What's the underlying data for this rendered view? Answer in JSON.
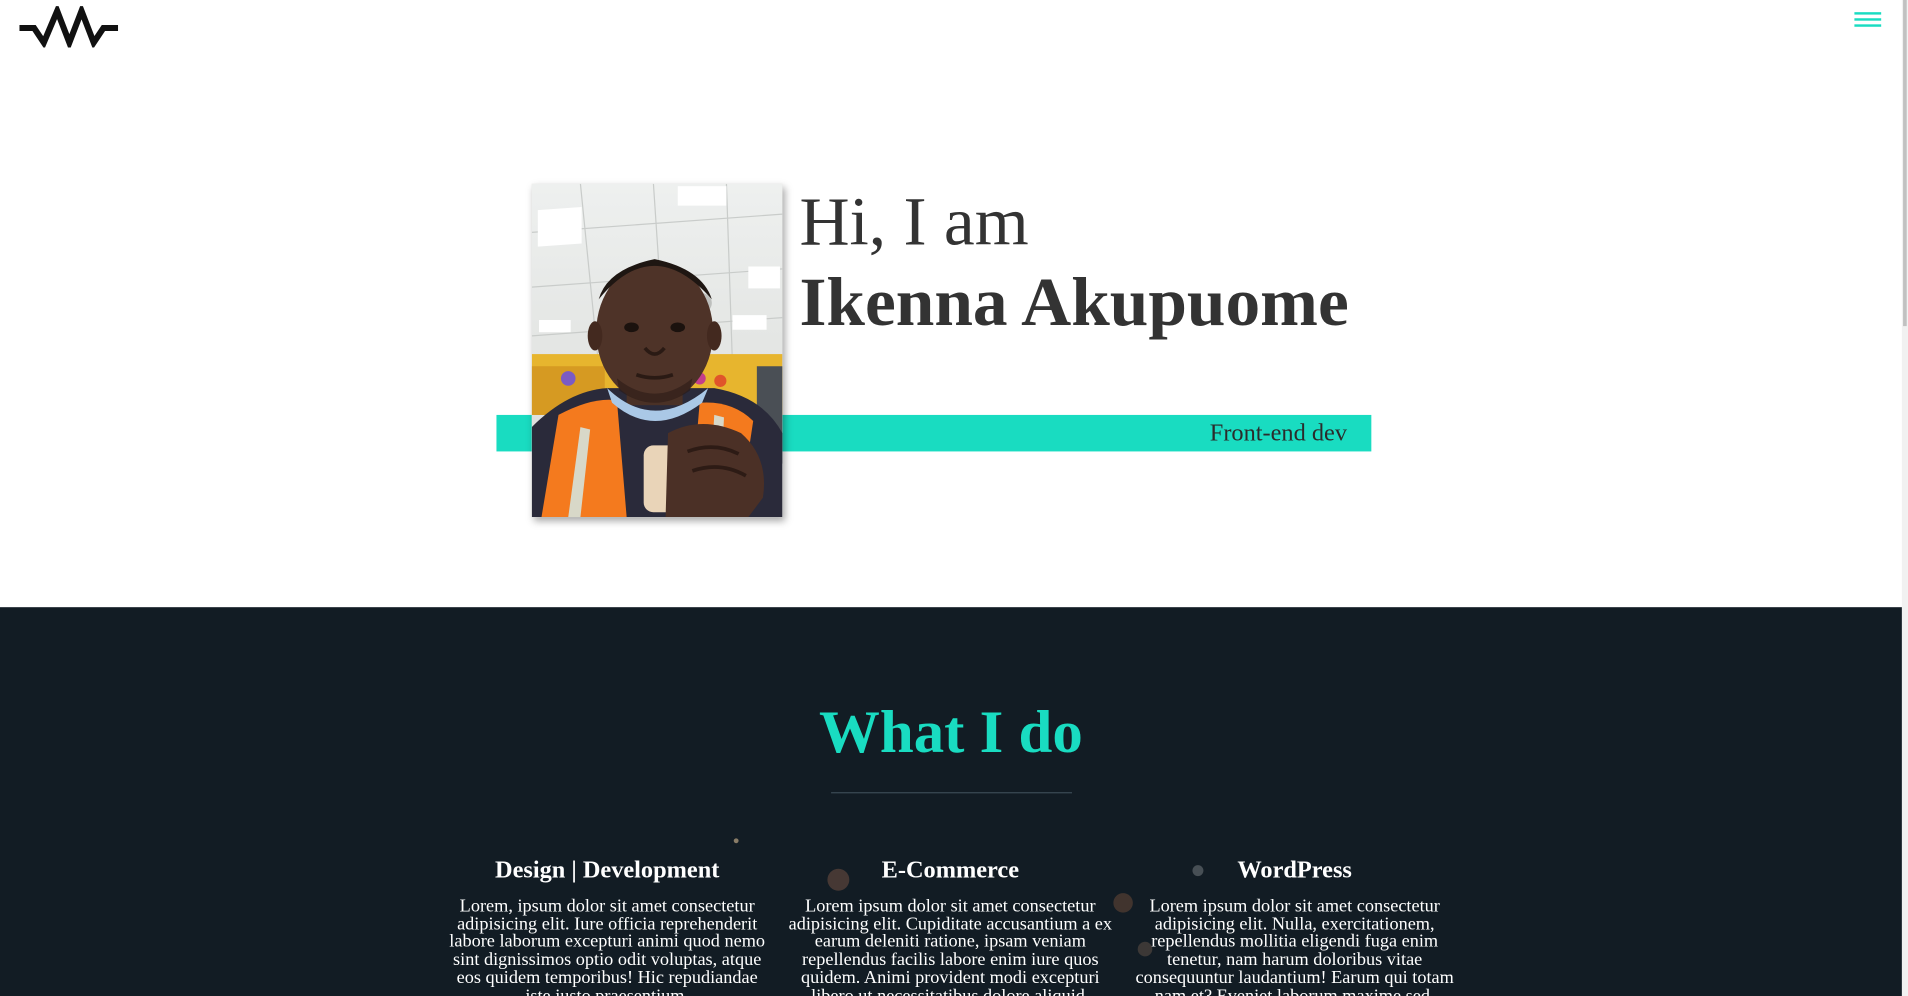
{
  "header": {
    "logo": "wave-logo",
    "menu_icon": "hamburger-menu-icon",
    "accent_color": "#19dcc1"
  },
  "hero": {
    "greeting": "Hi, I am",
    "name": "Ikenna Akupuome",
    "role": "Front-end dev",
    "photo": "profile-photo"
  },
  "services": {
    "title": "What I do",
    "background_color": "#121c24",
    "items": [
      {
        "title": "Design | Development",
        "text": "Lorem, ipsum dolor sit amet consectetur adipisicing elit. Iure officia reprehenderit labore laborum excepturi animi quod nemo sint dignissimos optio odit voluptas, atque eos quidem temporibus! Hic repudiandae iste iusto praesentium."
      },
      {
        "title": "E-Commerce",
        "text": "Lorem ipsum dolor sit amet consectetur adipisicing elit. Cupiditate accusantium a ex earum deleniti ratione, ipsam veniam repellendus facilis labore enim iure quos quidem. Animi provident modi excepturi libero ut necessitatibus dolore aliquid."
      },
      {
        "title": "WordPress",
        "text": "Lorem ipsum dolor sit amet consectetur adipisicing elit. Nulla, exercitationem, repellendus mollitia eligendi fuga enim tenetur, nam harum doloribus vitae consequuntur laudantium! Earum qui totam nam et? Eveniet laborum maxime sed."
      }
    ]
  }
}
